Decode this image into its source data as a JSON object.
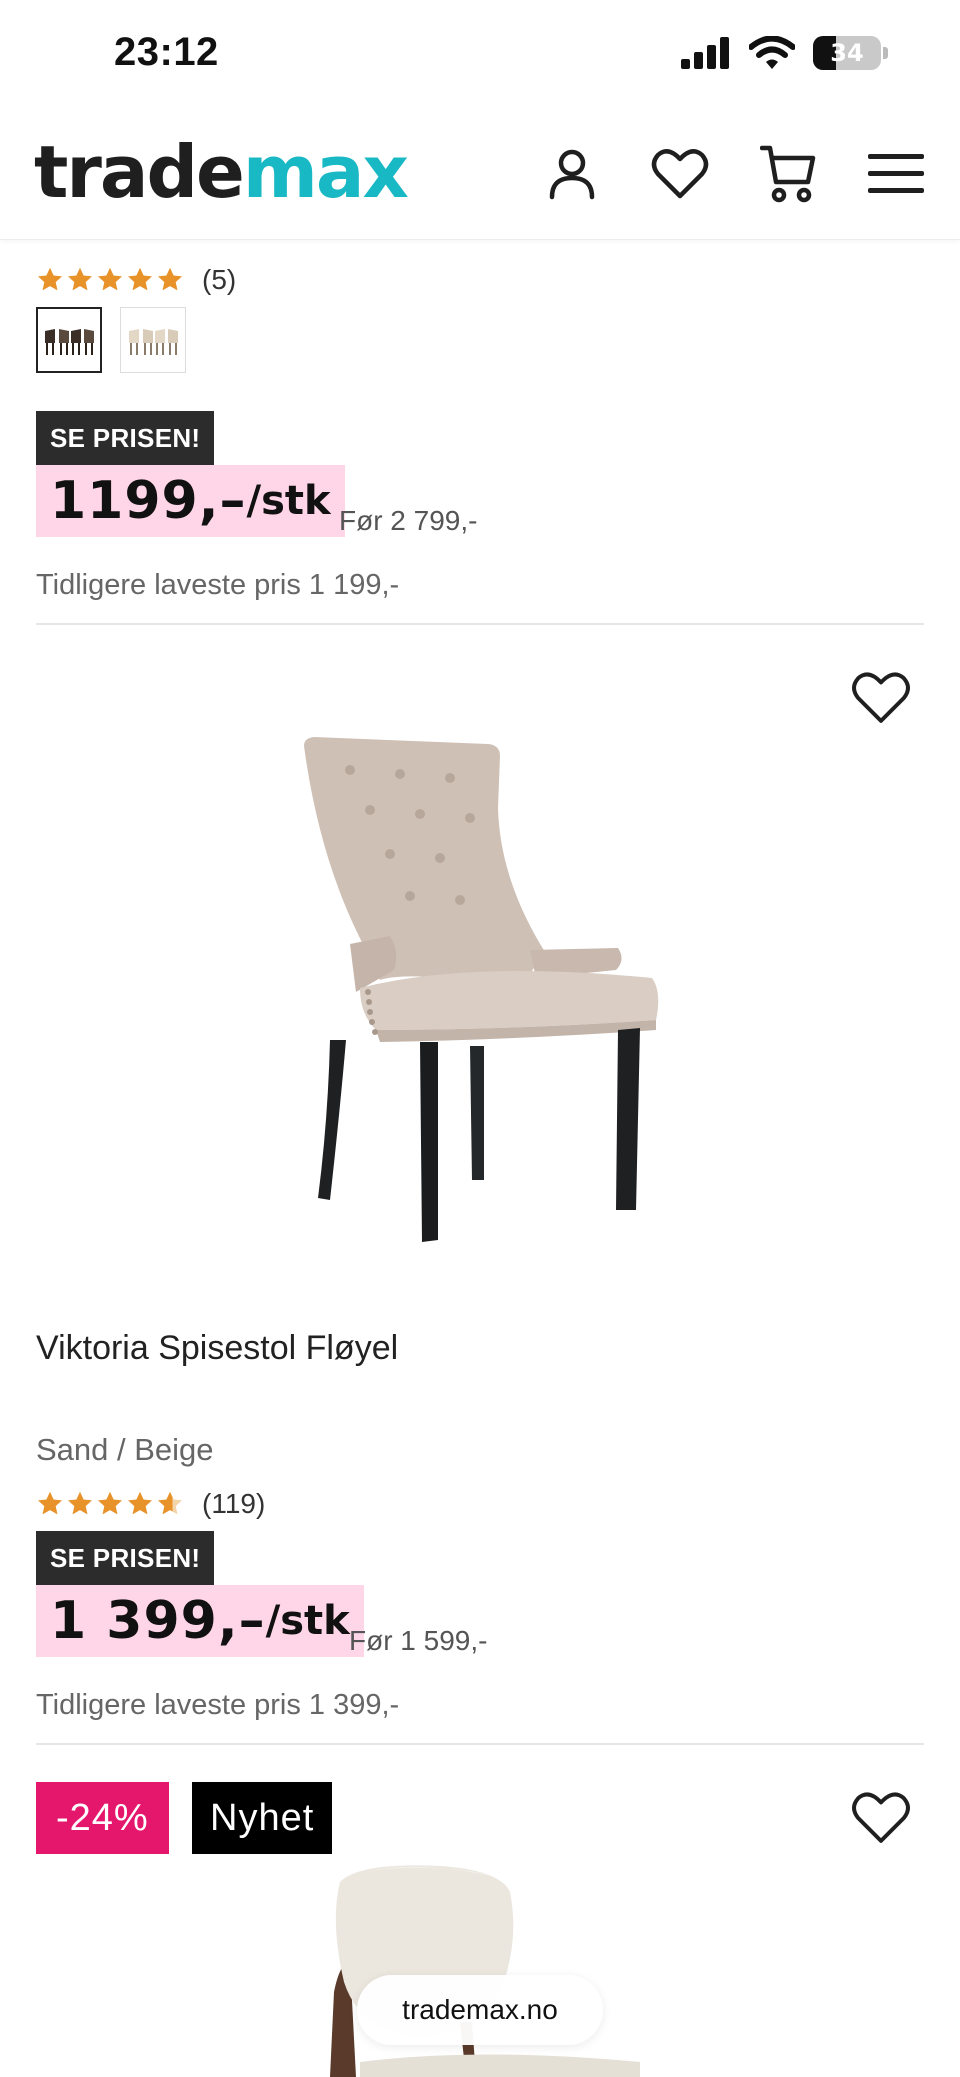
{
  "status_bar": {
    "time": "23:12",
    "battery": "34"
  },
  "header": {
    "logo_part1": "trade",
    "logo_part2": "max"
  },
  "products": [
    {
      "rating_count": "(5)",
      "badge": "SE PRISEN!",
      "price": "1199,–",
      "unit": "/stk",
      "before": "Før 2 799,-",
      "previous_lowest": "Tidligere laveste pris 1 199,-"
    },
    {
      "title": "Viktoria Spisestol Fløyel",
      "color": "Sand / Beige",
      "rating_count": "(119)",
      "badge": "SE PRISEN!",
      "price": "1 399,–",
      "unit": "/stk",
      "before": "Før 1 599,-",
      "previous_lowest": "Tidligere laveste pris 1 399,-"
    },
    {
      "discount": "-24%",
      "tag": "Nyhet"
    }
  ],
  "browser": {
    "url": "trademax.no"
  },
  "colors": {
    "brand_teal": "#18b8c4",
    "price_bg": "#ffd6e7",
    "discount_pink": "#e5176d",
    "star": "#e8932a"
  }
}
